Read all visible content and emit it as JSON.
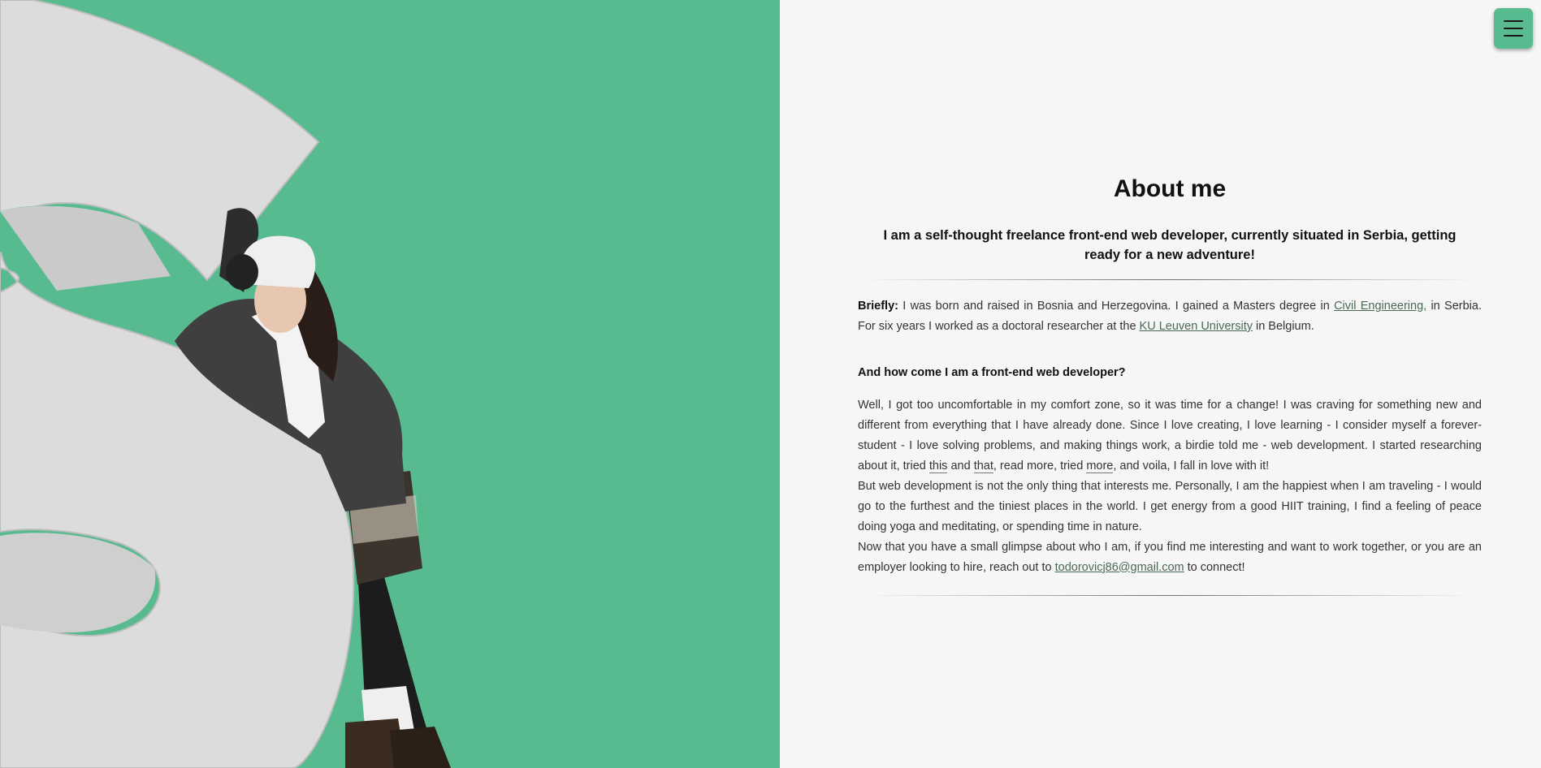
{
  "hero": {
    "background_color": "#58bb90",
    "image_subject": "woman-leaning-on-letter-s-sculpture"
  },
  "menu": {
    "icon": "hamburger-menu-icon",
    "accent": "#58bb90"
  },
  "about": {
    "title": "About me",
    "lead": "I am a self-thought freelance front-end web developer, currently situated in Serbia, getting ready for a new adventure!",
    "briefly_label": "Briefly:",
    "briefly_text_1": " I was born and raised in Bosnia and Herzegovina. I gained a Masters degree in ",
    "civil_engineering_link": "Civil Engineering,",
    "briefly_text_2": " in Serbia. For six years I worked as a doctoral researcher at the ",
    "ku_leuven_link": "KU Leuven University",
    "briefly_text_3": " in Belgium.",
    "question": "And how come I am a front-end web developer?",
    "answer_text_1": "Well, I got too uncomfortable in my comfort zone, so it was time for a change! I was craving for something new and different from everything that I have already done. Since I love creating, I love learning - I consider myself a forever-student - I love solving problems, and making things work, a birdie told me - web development. I started researching about it, tried ",
    "this_link": "this",
    "answer_and": " and ",
    "that_link": "that",
    "answer_text_2": ", read more, tried ",
    "more_link": "more",
    "answer_text_3": ", and voila, I fall in love with it!",
    "interests_text": "But web development is not the only thing that interests me. Personally, I am the happiest when I am traveling - I would go to the furthest and the tiniest places in the world. I get energy from a good HIIT training, I find a feeling of peace doing yoga and meditating, or spending time in nature.",
    "contact_text_1": "Now that you have a small glimpse about who I am, if you find me interesting and want to work together, or you are an employer looking to hire, reach out to ",
    "email_link": "todorovicj86@gmail.com",
    "contact_text_2": " to connect!"
  }
}
